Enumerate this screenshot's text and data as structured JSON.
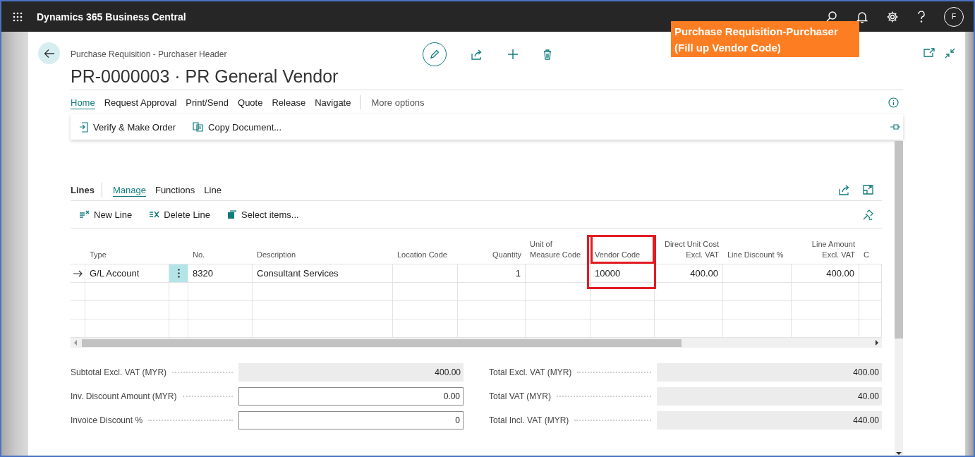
{
  "app": {
    "title": "Dynamics 365 Business Central",
    "avatar": "F"
  },
  "callout": [
    "Purchase Requisition-Purchaser",
    "(Fill up Vendor Code)"
  ],
  "page": {
    "breadcrumb": "Purchase Requisition - Purchaser Header",
    "title": "PR-0000003 · PR General Vendor"
  },
  "action_tabs": [
    {
      "label": "Home",
      "selected": true
    },
    {
      "label": "Request Approval",
      "selected": false
    },
    {
      "label": "Print/Send",
      "selected": false
    },
    {
      "label": "Quote",
      "selected": false
    },
    {
      "label": "Release",
      "selected": false
    },
    {
      "label": "Navigate",
      "selected": false
    }
  ],
  "more_options": "More options",
  "actions": [
    {
      "label": "Verify & Make Order",
      "kind": "verify"
    },
    {
      "label": "Copy Document...",
      "kind": "copy"
    }
  ],
  "lines": {
    "title": "Lines",
    "tabs": [
      {
        "label": "Manage",
        "selected": true
      },
      {
        "label": "Functions",
        "selected": false
      },
      {
        "label": "Line",
        "selected": false
      }
    ],
    "actions": [
      {
        "label": "New Line",
        "kind": "new"
      },
      {
        "label": "Delete Line",
        "kind": "delete"
      },
      {
        "label": "Select items...",
        "kind": "select"
      }
    ],
    "columns": [
      {
        "header": [
          "Type"
        ],
        "highlighted": false
      },
      {
        "header": [
          "No."
        ],
        "highlighted": false
      },
      {
        "header": [
          "Description"
        ],
        "highlighted": false
      },
      {
        "header": [
          "Location Code"
        ],
        "highlighted": false
      },
      {
        "header": [
          "Quantity"
        ],
        "highlighted": false
      },
      {
        "header": [
          "Unit of",
          "Measure Code"
        ],
        "highlighted": false
      },
      {
        "header": [
          "Vendor Code"
        ],
        "highlighted": true
      },
      {
        "header": [
          "Direct Unit Cost",
          "Excl. VAT"
        ],
        "highlighted": false
      },
      {
        "header": [
          "Line Discount %"
        ],
        "highlighted": false
      },
      {
        "header": [
          "Line Amount",
          "Excl. VAT"
        ],
        "highlighted": false
      },
      {
        "header": [
          "C"
        ],
        "highlighted": false
      }
    ],
    "rows": [
      {
        "current": true,
        "cells": [
          "G/L Account",
          "8320",
          "Consultant Services",
          null,
          "1",
          null,
          "10000",
          "400.00",
          null,
          "400.00",
          null
        ]
      }
    ]
  },
  "totals": {
    "left": [
      {
        "label": "Subtotal Excl. VAT (MYR)",
        "value": "400.00",
        "kind": "readonly"
      },
      {
        "label": "Inv. Discount Amount (MYR)",
        "value": "0.00",
        "kind": "input"
      },
      {
        "label": "Invoice Discount %",
        "value": "0",
        "kind": "input"
      }
    ],
    "right": [
      {
        "label": "Total Excl. VAT (MYR)",
        "value": "400.00",
        "kind": "readonly"
      },
      {
        "label": "Total VAT (MYR)",
        "value": "40.00",
        "kind": "readonly"
      },
      {
        "label": "Total Incl. VAT (MYR)",
        "value": "440.00",
        "kind": "readonly"
      }
    ]
  }
}
